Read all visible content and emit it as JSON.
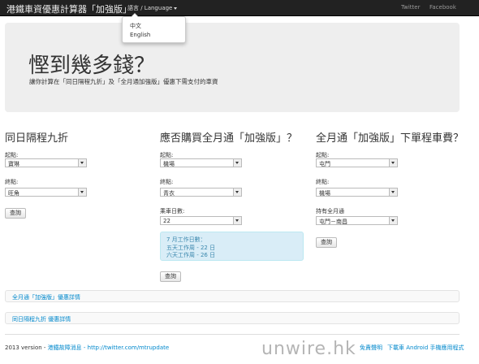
{
  "navbar": {
    "brand": "港鐵車資優惠計算器「加強版」",
    "language_label": "語言 / Language",
    "links": [
      "Twitter",
      "Facebook"
    ]
  },
  "language_menu": {
    "options": [
      "中文",
      "English"
    ]
  },
  "hero": {
    "title": "慳到幾多錢？",
    "subtitle": "讓你計算在「同日隔程九折」及「全月通加強版」優惠下需支付的車資"
  },
  "col1": {
    "heading": "同日隔程九折",
    "from_label": "起點:",
    "from_value": "寶琳",
    "to_label": "終點:",
    "to_value": "旺角",
    "button": "查詢"
  },
  "col2": {
    "heading": "應否購買全月通「加強版」？",
    "from_label": "起點:",
    "from_value": "機場",
    "to_label": "終點:",
    "to_value": "青衣",
    "days_label": "乘車日數:",
    "days_value": "22",
    "info_title": "7 月工作日數：",
    "info_line1": "五天工作周 - 22 日",
    "info_line2": "六天工作周 - 26 日",
    "button": "查詢"
  },
  "col3": {
    "heading": "全月通「加強版」下單程車費？",
    "from_label": "起點:",
    "from_value": "屯門",
    "to_label": "終點:",
    "to_value": "機場",
    "pass_label": "持有全月通",
    "pass_value": "屯門－南昌",
    "button": "查詢"
  },
  "links": {
    "monthly_details": "全月通「加強版」優惠詳情",
    "sameday_details": "同日隔程九折 優惠詳情"
  },
  "footer": {
    "version": "2013 version - ",
    "update_link": "港鐵故障消息 - http://twitter.com/mtrupdate",
    "disclaimer": "免責聲明",
    "android": "下載車 Android 手機應用程式"
  },
  "watermark": "unwire.hk"
}
